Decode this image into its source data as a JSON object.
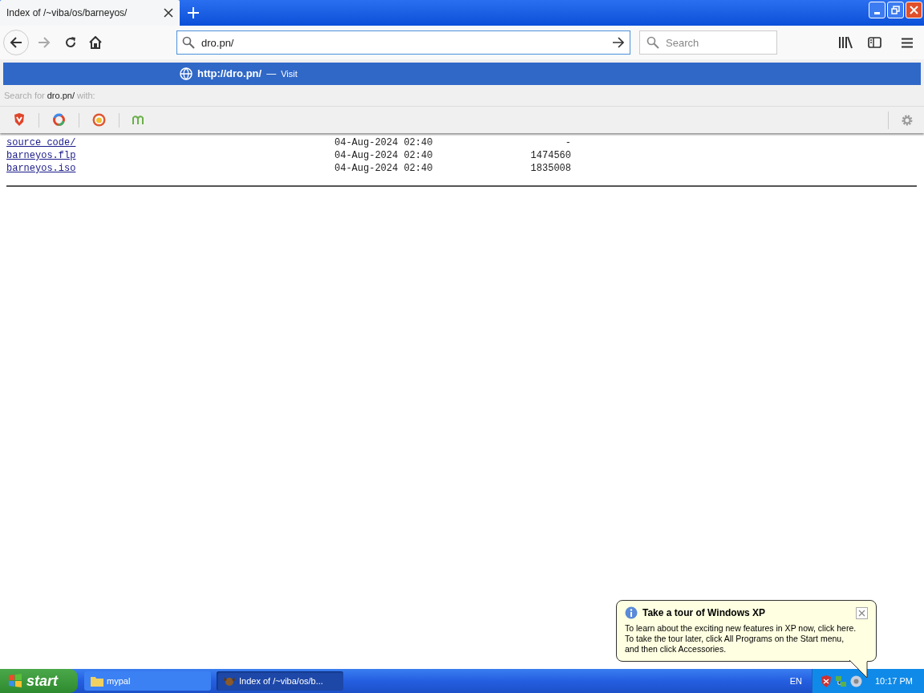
{
  "tab": {
    "title": "Index of /~viba/os/barneyos/",
    "selected": true
  },
  "toolbar": {
    "address_value": "dro.pn/",
    "search_placeholder": "Search"
  },
  "suggestion": {
    "url": "http://dro.pn/",
    "separator": "—",
    "action": "Visit"
  },
  "search_with": {
    "prefix": "Search for",
    "query": "dro.pn/",
    "suffix": "with:"
  },
  "listing": [
    {
      "name": "source code/",
      "date": "04-Aug-2024 02:40",
      "size": "-"
    },
    {
      "name": "barneyos.flp",
      "date": "04-Aug-2024 02:40",
      "size": "1474560"
    },
    {
      "name": "barneyos.iso",
      "date": "04-Aug-2024 02:40",
      "size": "1835008"
    }
  ],
  "balloon": {
    "title": "Take a tour of Windows XP",
    "body": "To learn about the exciting new features in XP now, click here.\nTo take the tour later, click All Programs on the Start menu,\nand then click Accessories."
  },
  "taskbar": {
    "start": "start",
    "tasks": [
      {
        "label": "mypal",
        "kind": "folder",
        "selected": false
      },
      {
        "label": "Index of /~viba/os/b...",
        "kind": "browser",
        "selected": true
      }
    ],
    "language": "EN",
    "clock": "10:17 PM"
  }
}
